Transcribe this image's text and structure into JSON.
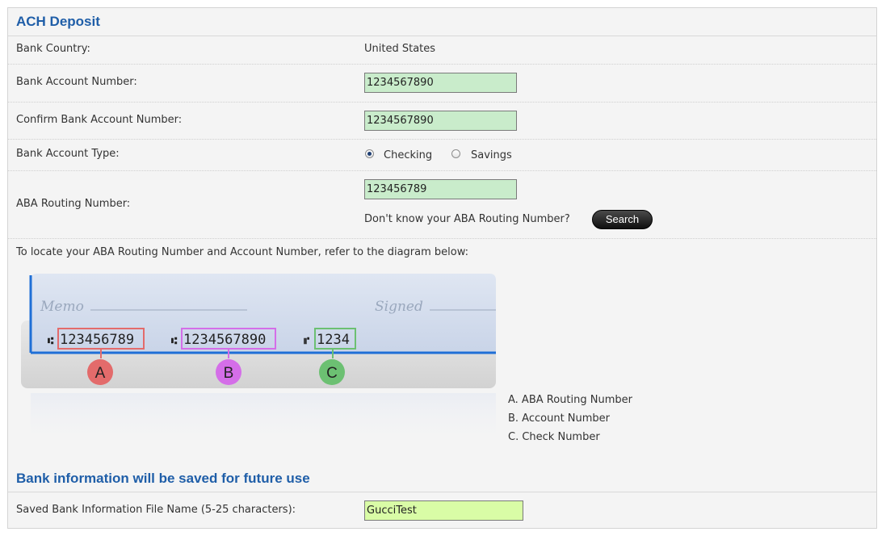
{
  "ach": {
    "title": "ACH Deposit",
    "country": {
      "label": "Bank Country:",
      "value": "United States"
    },
    "account_number": {
      "label": "Bank Account Number:",
      "value": "1234567890"
    },
    "confirm_account_number": {
      "label": "Confirm Bank Account Number:",
      "value": "1234567890"
    },
    "account_type": {
      "label": "Bank Account Type:",
      "options": [
        "Checking",
        "Savings"
      ],
      "selected": "Checking"
    },
    "routing": {
      "label": "ABA Routing Number:",
      "value": "123456789",
      "help_text": "Don't know your ABA Routing Number?",
      "search_label": "Search"
    },
    "diagram_intro": "To locate your ABA Routing Number and Account Number, refer to the diagram below:",
    "check_image": {
      "memo": "Memo",
      "signed": "Signed",
      "routing_digits": "123456789",
      "account_digits": "1234567890",
      "check_digits": "1234",
      "markers": [
        "A",
        "B",
        "C"
      ]
    },
    "legend": [
      "A. ABA Routing Number",
      "B. Account Number",
      "C. Check Number"
    ]
  },
  "save": {
    "title": "Bank information will be saved for future use",
    "file_name_label": "Saved Bank Information File Name (5-25 characters):",
    "file_name_value": "GucciTest"
  },
  "colors": {
    "heading": "#1f5ea8",
    "field_green": "#c9eccb",
    "field_lime": "#d9fca6",
    "marker_a": "#e36b6b",
    "marker_b": "#d46ee8",
    "marker_c": "#6cc072"
  }
}
